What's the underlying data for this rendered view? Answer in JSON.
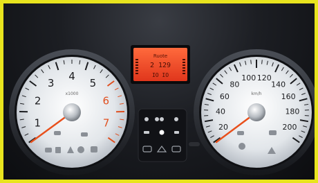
{
  "tachometer": {
    "labels": [
      "1",
      "2",
      "3",
      "4",
      "5",
      "6",
      "7"
    ],
    "unit": "x1000",
    "needle_value": 0.7
  },
  "speedometer": {
    "labels": [
      "20",
      "40",
      "60",
      "80",
      "100",
      "120",
      "140",
      "160",
      "180",
      "200"
    ],
    "unit": "km/h",
    "needle_value": 10
  },
  "display": {
    "line1": "Ruote",
    "line2": "2 129",
    "line3": "IO IO",
    "backlight_color": "#ff4a28"
  },
  "colors": {
    "bezel": "#2a2d33",
    "dial_face": "#e9ecef",
    "needle": "#e8501c",
    "redline": "#e05020",
    "frame": "#e8e41e"
  },
  "icons": [
    "indicator-lights-icon",
    "hazard-switch-icon",
    "lighting-switch-icon"
  ]
}
